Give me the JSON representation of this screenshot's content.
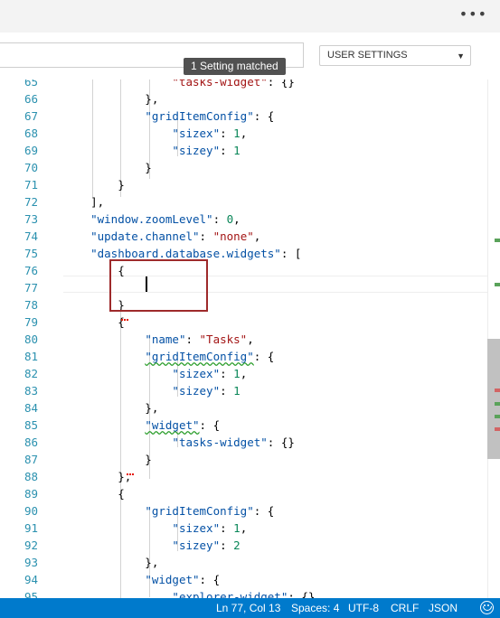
{
  "settings_header": {
    "matched_badge": "1 Setting matched",
    "scope_select": "USER SETTINGS",
    "search_value": ""
  },
  "editor": {
    "lines": [
      {
        "n": "65",
        "tokens": [
          [
            "pun",
            "                "
          ],
          [
            "str",
            "\"tasks-widget\""
          ],
          [
            "pun",
            ": {}"
          ]
        ]
      },
      {
        "n": "66",
        "tokens": [
          [
            "pun",
            "            },"
          ]
        ]
      },
      {
        "n": "67",
        "tokens": [
          [
            "pun",
            "            "
          ],
          [
            "key",
            "\"gridItemConfig\""
          ],
          [
            "pun",
            ": {"
          ]
        ]
      },
      {
        "n": "68",
        "tokens": [
          [
            "pun",
            "                "
          ],
          [
            "key",
            "\"sizex\""
          ],
          [
            "pun",
            ": "
          ],
          [
            "num",
            "1"
          ],
          [
            "pun",
            ","
          ]
        ]
      },
      {
        "n": "69",
        "tokens": [
          [
            "pun",
            "                "
          ],
          [
            "key",
            "\"sizey\""
          ],
          [
            "pun",
            ": "
          ],
          [
            "num",
            "1"
          ]
        ]
      },
      {
        "n": "70",
        "tokens": [
          [
            "pun",
            "            }"
          ]
        ]
      },
      {
        "n": "71",
        "tokens": [
          [
            "pun",
            "        }"
          ]
        ]
      },
      {
        "n": "72",
        "tokens": [
          [
            "pun",
            "    ],"
          ]
        ]
      },
      {
        "n": "73",
        "tokens": [
          [
            "pun",
            "    "
          ],
          [
            "key",
            "\"window.zoomLevel\""
          ],
          [
            "pun",
            ": "
          ],
          [
            "num",
            "0"
          ],
          [
            "pun",
            ","
          ]
        ]
      },
      {
        "n": "74",
        "tokens": [
          [
            "pun",
            "    "
          ],
          [
            "key",
            "\"update.channel\""
          ],
          [
            "pun",
            ": "
          ],
          [
            "str",
            "\"none\""
          ],
          [
            "pun",
            ","
          ]
        ]
      },
      {
        "n": "75",
        "tokens": [
          [
            "pun",
            "    "
          ],
          [
            "key",
            "\"dashboard.database.widgets\""
          ],
          [
            "pun",
            ": ["
          ]
        ]
      },
      {
        "n": "76",
        "tokens": [
          [
            "pun",
            "        {"
          ]
        ]
      },
      {
        "n": "77",
        "tokens": [
          [
            "pun",
            ""
          ]
        ]
      },
      {
        "n": "78",
        "tokens": [
          [
            "pun",
            "        }"
          ]
        ]
      },
      {
        "n": "79",
        "tokens": [
          [
            "pun",
            "        {"
          ]
        ]
      },
      {
        "n": "80",
        "tokens": [
          [
            "pun",
            "            "
          ],
          [
            "key",
            "\"name\""
          ],
          [
            "pun",
            ": "
          ],
          [
            "str",
            "\"Tasks\""
          ],
          [
            "pun",
            ","
          ]
        ]
      },
      {
        "n": "81",
        "tokens": [
          [
            "pun",
            "            "
          ],
          [
            "keysq",
            "\"gridItemConfig\""
          ],
          [
            "pun",
            ": {"
          ]
        ]
      },
      {
        "n": "82",
        "tokens": [
          [
            "pun",
            "                "
          ],
          [
            "key",
            "\"sizex\""
          ],
          [
            "pun",
            ": "
          ],
          [
            "num",
            "1"
          ],
          [
            "pun",
            ","
          ]
        ]
      },
      {
        "n": "83",
        "tokens": [
          [
            "pun",
            "                "
          ],
          [
            "key",
            "\"sizey\""
          ],
          [
            "pun",
            ": "
          ],
          [
            "num",
            "1"
          ]
        ]
      },
      {
        "n": "84",
        "tokens": [
          [
            "pun",
            "            },"
          ]
        ]
      },
      {
        "n": "85",
        "tokens": [
          [
            "pun",
            "            "
          ],
          [
            "keysq",
            "\"widget\""
          ],
          [
            "pun",
            ": {"
          ]
        ]
      },
      {
        "n": "86",
        "tokens": [
          [
            "pun",
            "                "
          ],
          [
            "key",
            "\"tasks-widget\""
          ],
          [
            "pun",
            ": {}"
          ]
        ]
      },
      {
        "n": "87",
        "tokens": [
          [
            "pun",
            "            }"
          ]
        ]
      },
      {
        "n": "88",
        "tokens": [
          [
            "pun",
            "        }"
          ],
          [
            "pun",
            ","
          ]
        ]
      },
      {
        "n": "89",
        "tokens": [
          [
            "pun",
            "        {"
          ]
        ]
      },
      {
        "n": "90",
        "tokens": [
          [
            "pun",
            "            "
          ],
          [
            "key",
            "\"gridItemConfig\""
          ],
          [
            "pun",
            ": {"
          ]
        ]
      },
      {
        "n": "91",
        "tokens": [
          [
            "pun",
            "                "
          ],
          [
            "key",
            "\"sizex\""
          ],
          [
            "pun",
            ": "
          ],
          [
            "num",
            "1"
          ],
          [
            "pun",
            ","
          ]
        ]
      },
      {
        "n": "92",
        "tokens": [
          [
            "pun",
            "                "
          ],
          [
            "key",
            "\"sizey\""
          ],
          [
            "pun",
            ": "
          ],
          [
            "num",
            "2"
          ]
        ]
      },
      {
        "n": "93",
        "tokens": [
          [
            "pun",
            "            },"
          ]
        ]
      },
      {
        "n": "94",
        "tokens": [
          [
            "pun",
            "            "
          ],
          [
            "key",
            "\"widget\""
          ],
          [
            "pun",
            ": {"
          ]
        ]
      },
      {
        "n": "95",
        "tokens": [
          [
            "pun",
            "                "
          ],
          [
            "key",
            "\"explorer-widget\""
          ],
          [
            "pun",
            ": {}"
          ]
        ]
      }
    ],
    "ruler_marks": [
      {
        "color": "#5aa25a"
      },
      {
        "color": "#5aa25a"
      },
      {
        "color": "#d26464"
      },
      {
        "color": "#5aa25a"
      },
      {
        "color": "#5aa25a"
      },
      {
        "color": "#d26464"
      }
    ]
  },
  "status_bar": {
    "position": "Ln 77, Col 13",
    "spaces": "Spaces: 4",
    "encoding": "UTF-8",
    "line_ending": "CRLF",
    "language": "JSON"
  },
  "icons": {
    "more": "more-icon",
    "dropdown": "chevron-down-icon",
    "feedback": "smiley-icon"
  },
  "colors": {
    "status_bar": "#007acc",
    "line_numbers": "#2b91af",
    "json_key": "#0451a5",
    "json_string": "#a31515",
    "json_number": "#098658",
    "highlight_box": "#9e2a2b"
  }
}
